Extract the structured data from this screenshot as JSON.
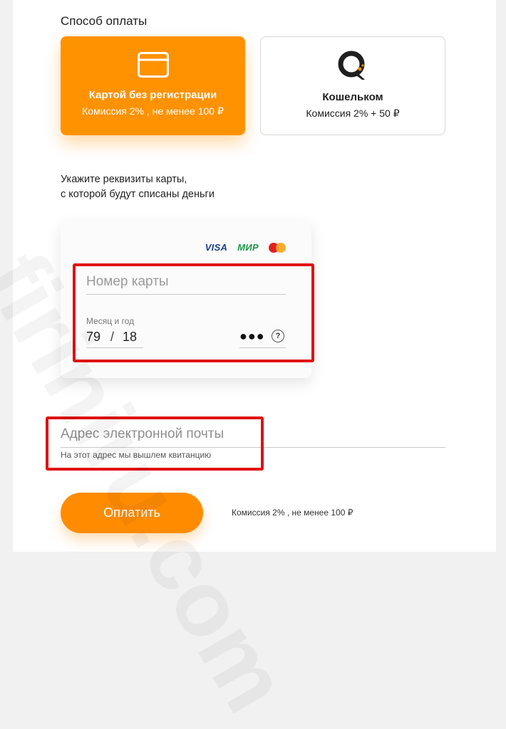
{
  "payment": {
    "section_title": "Способ оплаты",
    "methods": [
      {
        "title": "Картой без регистрации",
        "commission": "Комиссия 2% , не менее 100 ₽",
        "icon": "credit-card-icon",
        "selected": true
      },
      {
        "title": "Кошельком",
        "commission": "Комиссия 2% + 50 ₽",
        "icon": "qiwi-logo-icon",
        "selected": false
      }
    ]
  },
  "card_form": {
    "hint_line1": "Укажите реквизиты карты,",
    "hint_line2": "с которой будут списаны деньги",
    "brands": [
      "VISA",
      "МИР",
      "mastercard-logo-icon"
    ],
    "card_number_placeholder": "Номер карты",
    "expiry_label": "Месяц и год",
    "expiry_month": "79",
    "expiry_separator": "/",
    "expiry_year": "18",
    "cvc_value": "●●●",
    "cvc_help": "?"
  },
  "email": {
    "placeholder": "Адрес электронной почты",
    "hint": "На этот адрес мы вышлем квитанцию"
  },
  "footer": {
    "pay_label": "Оплатить",
    "commission": "Комиссия 2% , не менее 100 ₽"
  },
  "colors": {
    "accent": "#ff9200",
    "highlight": "#e01212"
  },
  "watermark": "firiniru.com"
}
